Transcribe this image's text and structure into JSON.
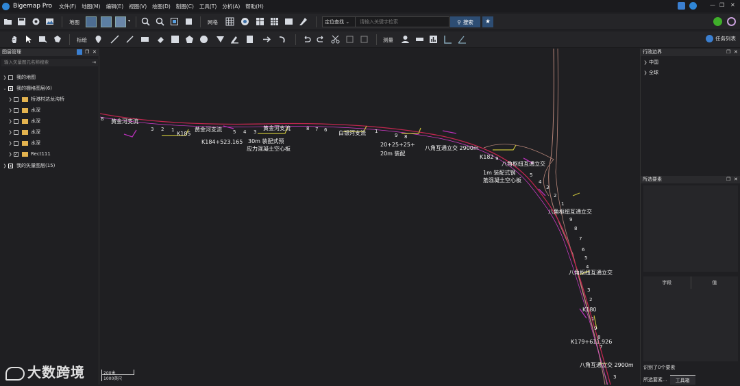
{
  "titlebar": {
    "app_name": "Bigemap Pro",
    "menus": [
      "文件(F)",
      "地图(M)",
      "编辑(E)",
      "视图(V)",
      "绘图(D)",
      "制图(C)",
      "工具(T)",
      "分析(A)",
      "帮助(H)"
    ]
  },
  "toolbar1": {
    "map_label": "地图",
    "grid_label": "网格",
    "search_mode": "定位查找",
    "search_placeholder": "请输入关键字检索",
    "search_button": "搜索"
  },
  "toolbar2": {
    "annotate_label": "标绘",
    "measure_label": "测量",
    "task_list_label": "任务列表"
  },
  "layer_panel": {
    "title": "图层管理",
    "filter_placeholder": "输入矢量图元名称搜索",
    "items": [
      {
        "label": "我的地图",
        "level": 0,
        "checked": "none"
      },
      {
        "label": "我的栅格图层(6)",
        "level": 0,
        "checked": "partial"
      },
      {
        "label": "桥港村达龙沟桥",
        "level": 1,
        "checked": "none"
      },
      {
        "label": "水深",
        "level": 1,
        "checked": "none"
      },
      {
        "label": "水深",
        "level": 1,
        "checked": "none"
      },
      {
        "label": "水深",
        "level": 1,
        "checked": "none"
      },
      {
        "label": "水深",
        "level": 1,
        "checked": "none"
      },
      {
        "label": "Rect111",
        "level": 1,
        "checked": "checked"
      },
      {
        "label": "我的矢量图层(15)",
        "level": 0,
        "checked": "partial"
      }
    ]
  },
  "admin_panel": {
    "title": "行政边界",
    "items": [
      "中国",
      "全球"
    ]
  },
  "selected_panel": {
    "title": "所选要素",
    "col_field": "字段",
    "col_value": "值",
    "status": "识别了0个要素",
    "tabs": [
      "所选要素...",
      "工具箱"
    ]
  },
  "map": {
    "labels": [
      "黄金河支流",
      "黄金河支流",
      "黄金河支流",
      "白银河支流",
      "K185",
      "K184+523.165",
      "30m 装配式预",
      "应力混凝土空心板",
      "20+25+25+",
      "20m 装配",
      "八角互通立交 2900m",
      "K182",
      "八角枢纽互通立交",
      "1m 装配式钢",
      "筋混凝土空心板",
      "八角枢纽互通立交",
      "八角枢纽互通立交",
      "K180",
      "K179+611.926",
      "八角互通立交 2900m"
    ],
    "digits": [
      "8",
      "3",
      "2",
      "1",
      "5",
      "4",
      "3",
      "8",
      "7",
      "6",
      "1",
      "9",
      "8",
      "9",
      "5",
      "4",
      "3",
      "2",
      "1",
      "9",
      "8",
      "7",
      "6",
      "5",
      "4",
      "3",
      "2",
      "1",
      "9",
      "8",
      "7",
      "3"
    ],
    "scale_top": "200米",
    "scale_bottom": "1000英尺"
  },
  "watermark": "大数跨境"
}
